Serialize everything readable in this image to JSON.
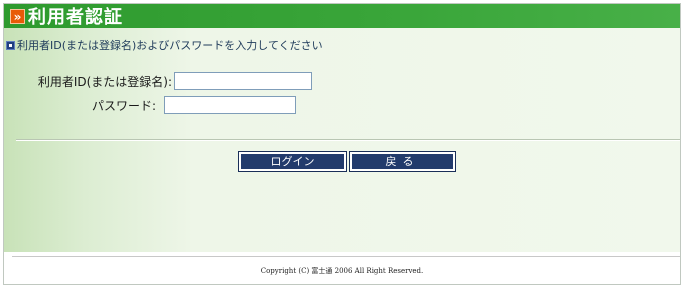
{
  "header": {
    "marker": "»",
    "title": "利用者認証"
  },
  "instruction": {
    "text": "利用者ID(または登録名)およびパスワードを入力してください"
  },
  "form": {
    "user_id_label": "利用者ID(または登録名):",
    "user_id_value": "",
    "password_label": "パスワード:",
    "password_value": ""
  },
  "buttons": {
    "login_label": "ログイン",
    "back_label": "戻る"
  },
  "footer": {
    "copyright": "Copyright (C) 富士通 2006 All Right Reserved."
  },
  "colors": {
    "header_green": "#3aa63a",
    "title_marker_orange": "#e85a08",
    "button_navy": "#223b6c",
    "content_light_green": "#eef6e8"
  },
  "icons": {
    "title_marker": "double-chevron-right-icon",
    "instruction": "info-square-icon"
  }
}
